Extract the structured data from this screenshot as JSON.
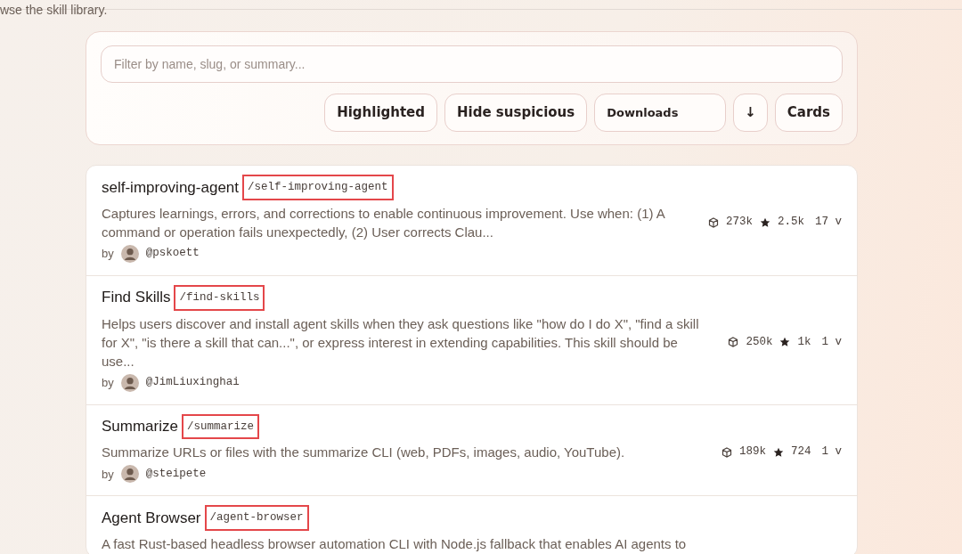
{
  "intro": "wse the skill library.",
  "filter": {
    "placeholder": "Filter by name, slug, or summary..."
  },
  "controls": [
    {
      "kind": "toggle",
      "label": "Highlighted"
    },
    {
      "kind": "toggle",
      "label": "Hide suspicious"
    },
    {
      "kind": "select",
      "label": "Downloads"
    },
    {
      "kind": "toggle",
      "label": "↓"
    },
    {
      "kind": "toggle",
      "label": "Cards"
    }
  ],
  "skills": [
    {
      "name": "self-improving-agent",
      "slug": "/self-improving-agent",
      "annotated": true,
      "summary": "Captures learnings, errors, and corrections to enable continuous improvement. Use when: (1) A command or operation fails unexpectedly, (2) User corrects Clau...",
      "by": "by",
      "author": "@pskoett",
      "downloads": "273k",
      "stars": "2.5k",
      "versions": "17 v"
    },
    {
      "name": "Find Skills",
      "slug": "/find-skills",
      "annotated": true,
      "summary": "Helps users discover and install agent skills when they ask questions like \"how do I do X\", \"find a skill for X\", \"is there a skill that can...\", or express interest in extending capabilities. This skill should be use...",
      "by": "by",
      "author": "@JimLiuxinghai",
      "downloads": "250k",
      "stars": "1k",
      "versions": "1 v"
    },
    {
      "name": "Summarize",
      "slug": "/summarize",
      "annotated": true,
      "summary": "Summarize URLs or files with the summarize CLI (web, PDFs, images, audio, YouTube).",
      "by": "by",
      "author": "@steipete",
      "downloads": "189k",
      "stars": "724",
      "versions": "1 v"
    },
    {
      "name": "Agent Browser",
      "slug": "/agent-browser",
      "annotated": true,
      "summary": "A fast Rust-based headless browser automation CLI with Node.js fallback that enables AI agents to"
    }
  ]
}
